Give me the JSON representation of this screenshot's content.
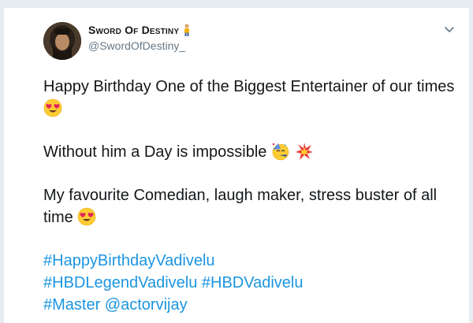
{
  "tweet": {
    "display_name": "Sword Of Destiny",
    "handle": "@SwordOfDestiny_",
    "line1": "Happy Birthday One of the Biggest Entertainer of our times",
    "line2": "Without him a Day is impossible",
    "line3": "My favourite Comedian, laugh maker, stress buster of all time",
    "hashtags": {
      "tag1": "#HappyBirthdayVadivelu",
      "tag2": "#HBDLegendVadivelu",
      "tag3": "#HBDVadivelu",
      "tag4": "#Master",
      "mention": "@actorvijay"
    }
  },
  "icons": {
    "emoji_heart_eyes": "smiling-face-with-heart-eyes",
    "emoji_party": "partying-face",
    "emoji_collision": "collision",
    "caret": "chevron-down-icon",
    "name_suffix": "man-standing-emoji"
  },
  "colors": {
    "link": "#1b95e0",
    "text": "#14171a",
    "secondary": "#657786"
  }
}
